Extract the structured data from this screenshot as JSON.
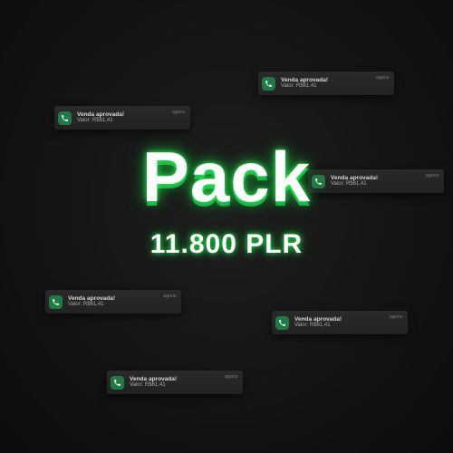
{
  "headline": "Pack",
  "subline": "11.800 PLR",
  "notifications": [
    {
      "title": "Venda aprovada!",
      "value": "Valor: R$61,41",
      "time": "agora",
      "icon": "phone-icon"
    },
    {
      "title": "Venda aprovada!",
      "value": "Valor: R$61,41",
      "time": "agora",
      "icon": "phone-icon"
    },
    {
      "title": "Venda aprovada!",
      "value": "Valor: R$61,41",
      "time": "agora",
      "icon": "phone-icon"
    },
    {
      "title": "Venda aprovada!",
      "value": "Valor: R$61,41",
      "time": "agora",
      "icon": "phone-icon"
    },
    {
      "title": "Venda aprovada!",
      "value": "Valor: R$61,41",
      "time": "agora",
      "icon": "phone-icon"
    },
    {
      "title": "Venda aprovada!",
      "value": "Valor: R$61,41",
      "time": "agora",
      "icon": "phone-icon"
    }
  ],
  "colors": {
    "accent": "#1aa84a",
    "background": "#141414",
    "icon_bg": "#1f7a45"
  }
}
